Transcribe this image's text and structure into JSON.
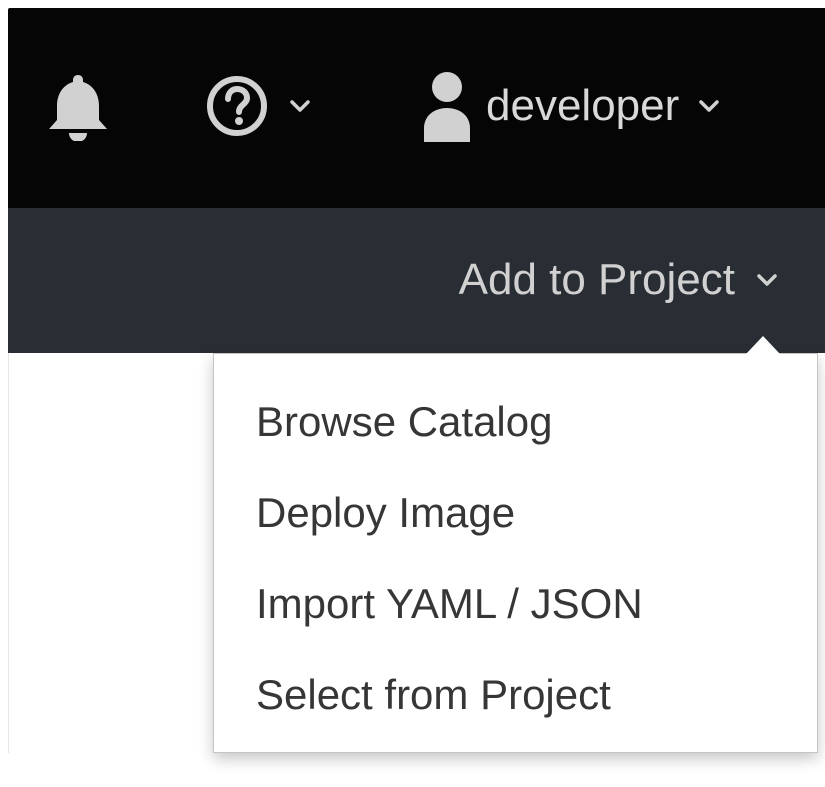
{
  "masthead": {
    "notifications": {
      "icon": "bell-icon"
    },
    "help": {
      "icon": "question-circle-icon",
      "chevron": "chevron-down-icon"
    },
    "user": {
      "icon": "user-icon",
      "name": "developer",
      "chevron": "chevron-down-icon"
    }
  },
  "secondary_bar": {
    "add_to_project_label": "Add to Project",
    "chevron": "chevron-down-icon"
  },
  "dropdown": {
    "items": [
      {
        "label": "Browse Catalog"
      },
      {
        "label": "Deploy Image"
      },
      {
        "label": "Import YAML / JSON"
      },
      {
        "label": "Select from Project"
      }
    ]
  },
  "colors": {
    "masthead_bg": "#050505",
    "secondary_bar_bg": "#292e34",
    "nav_text": "#d1d1d1",
    "menu_text": "#363636",
    "menu_bg": "#ffffff"
  }
}
